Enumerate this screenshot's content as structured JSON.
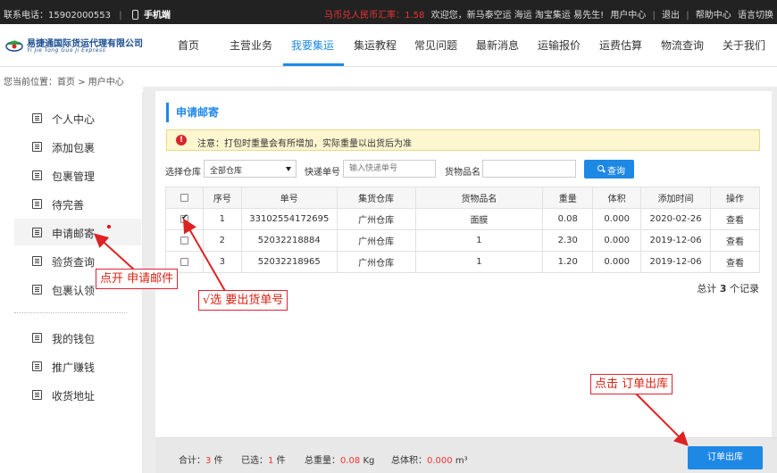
{
  "topbar": {
    "phone": "联系电话：15902000553",
    "mobile": "手机端",
    "rate": "马币兑人民币汇率：1.58",
    "welcome": "欢迎您，新马泰空运 海运 淘宝集运 易先生!",
    "user_center": "用户中心",
    "logout": "退出",
    "help": "帮助中心",
    "lang": "语言切换"
  },
  "logo": {
    "cn": "易捷通国际货运代理有限公司",
    "en": "Yi Jie Tong Guo Ji Express"
  },
  "nav": [
    "首页",
    "主营业务",
    "我要集运",
    "集运教程",
    "常见问题",
    "最新消息",
    "运输报价",
    "运费估算",
    "物流查询",
    "关于我们"
  ],
  "breadcrumb": "您当前位置：首页 > 用户中心",
  "sidebar": [
    "个人中心",
    "添加包裹",
    "包裹管理",
    "待完善",
    "申请邮寄",
    "验货查询",
    "包裹认领",
    "我的钱包",
    "推广赚钱",
    "收货地址"
  ],
  "panel": {
    "title": "申请邮寄",
    "notice": "注意：打包时重量会有所增加，实际重量以出货后为准",
    "warehouse_label": "选择仓库",
    "warehouse_value": "全部仓库",
    "tracking_label": "快递单号",
    "tracking_placeholder": "输入快递单号",
    "goods_label": "货物品名",
    "search": "查询"
  },
  "table": {
    "headers": [
      "",
      "序号",
      "单号",
      "集货仓库",
      "货物品名",
      "重量",
      "体积",
      "添加时间",
      "操作"
    ],
    "rows": [
      {
        "checked": true,
        "no": "1",
        "order": "33102554172695",
        "warehouse": "广州仓库",
        "goods": "面膜",
        "weight": "0.08",
        "volume": "0.000",
        "date": "2020-02-26",
        "action": "查看"
      },
      {
        "checked": false,
        "no": "2",
        "order": "52032218884",
        "warehouse": "广州仓库",
        "goods": "1",
        "weight": "2.30",
        "volume": "0.000",
        "date": "2019-12-06",
        "action": "查看"
      },
      {
        "checked": false,
        "no": "3",
        "order": "52032218965",
        "warehouse": "广州仓库",
        "goods": "1",
        "weight": "1.20",
        "volume": "0.000",
        "date": "2019-12-06",
        "action": "查看"
      }
    ]
  },
  "summary": {
    "prefix": "总计",
    "count": "3",
    "suffix": "个记录"
  },
  "bottom": {
    "total_label": "合计：",
    "total": "3",
    "total_unit": "件",
    "selected_label": "已选：",
    "selected": "1",
    "selected_unit": "件",
    "weight_label": "总重量：",
    "weight": "0.08",
    "weight_unit": "Kg",
    "volume_label": "总体积：",
    "volume": "0.000",
    "volume_unit": "m³",
    "outbound": "订单出库"
  },
  "callouts": {
    "open": "点开 申请邮件",
    "select": "√选 要出货单号",
    "click": "点击 订单出库"
  },
  "colors": {
    "accent": "#1e88e5",
    "annotation": "#dd2222",
    "topbar": "#222222"
  }
}
